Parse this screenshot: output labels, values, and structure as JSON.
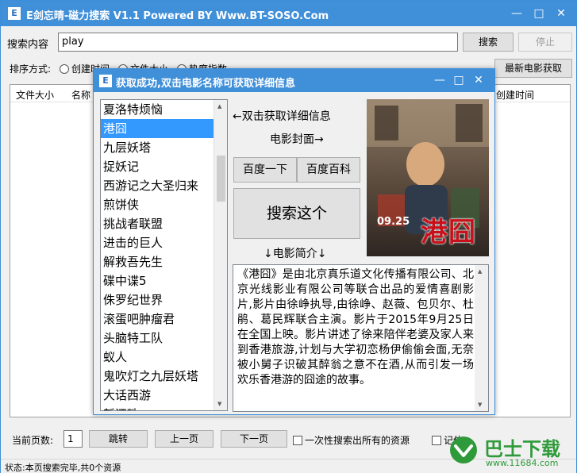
{
  "app": {
    "icon_letter": "E",
    "title": "E剑忘晴-磁力搜索 V1.1  Powered BY Www.BT-SOSO.Com"
  },
  "search": {
    "label": "搜索内容",
    "value": "play",
    "search_button": "搜索",
    "stop_button": "停止"
  },
  "sort": {
    "label": "排序方式:",
    "options": [
      "创建时间",
      "文件大小",
      "热度指数"
    ]
  },
  "latest_button": "最新电影获取",
  "results": {
    "columns": [
      "文件大小",
      "名称",
      "创建时间"
    ]
  },
  "pager": {
    "current_label": "当前页数:",
    "current_value": "1",
    "jump_button": "跳转",
    "prev_button": "上一页",
    "next_button": "下一页",
    "all_results_checkbox": "一次性搜索出所有的资源",
    "remember_checkbox": "记住"
  },
  "status": "状态:本页搜索完毕,共0个资源",
  "dialog": {
    "icon_letter": "E",
    "title": "获取成功,双击电影名称可获取详细信息",
    "movies": [
      "夏洛特烦恼",
      "港囧",
      "九层妖塔",
      "捉妖记",
      "西游记之大圣归来",
      "煎饼侠",
      "挑战者联盟",
      "进击的巨人",
      "解救吾先生",
      "碟中谍5",
      "侏罗纪世界",
      "滚蛋吧肿瘤君",
      "头脑特工队",
      "蚁人",
      "鬼吹灯之九层妖塔",
      "大话西游",
      "新还珠"
    ],
    "selected_movie": "港囧",
    "hint_details": "←双击获取详细信息",
    "hint_cover": "电影封面→",
    "baidu_search_button": "百度一下",
    "baidu_baike_button": "百度百科",
    "search_this_button": "搜索这个",
    "synopsis_label": "↓电影简介↓",
    "synopsis": "《港囧》是由北京真乐道文化传播有限公司、北京光线影业有限公司等联合出品的爱情喜剧影片,影片由徐峥执导,由徐峥、赵薇、包贝尔、杜鹃、葛民辉联合主演。影片于2015年9月25日在全国上映。影片讲述了徐来陪伴老婆及家人来到香港旅游,计划与大学初恋杨伊偷偷会面,无奈被小舅子识破其醉翁之意不在酒,从而引发一场欢乐香港游的囧途的故事。",
    "poster": {
      "title_text": "港囧",
      "date_text": "09.25"
    }
  },
  "watermark": {
    "brand": "巴士下载",
    "url": "www.11684.com"
  },
  "colors": {
    "title_bar": "#3f8fd9",
    "selection": "#3399ff",
    "watermark_green": "#2f9a3a",
    "poster_red": "#c8101a"
  }
}
